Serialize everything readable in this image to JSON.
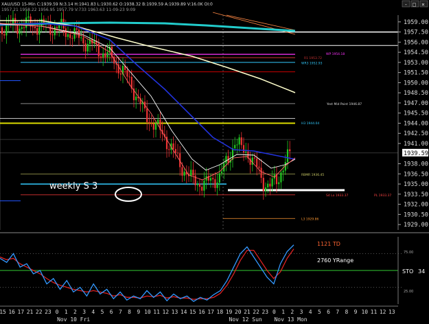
{
  "header": {
    "symbol_line": "XAU/USD 15-Min C:1939.59 N:3.14 H:1941.83 L:1930.62 O:1938.32 B:1939.59 A:1939.89 V:16.0K OI:0",
    "sub_line": "1957.21 1958.22 1956.95 1957.79 V:733 1963.63 11-09-23 9:09"
  },
  "window_controls": {
    "minimize": "-",
    "maximize": "□",
    "close": "×"
  },
  "price_axis": {
    "ticks": [
      "1959.00",
      "1957.50",
      "1956.00",
      "1954.50",
      "1953.00",
      "1951.50",
      "1950.00",
      "1948.50",
      "1947.00",
      "1945.50",
      "1944.00",
      "1942.50",
      "1941.00",
      "1939.59",
      "1938.00",
      "1936.50",
      "1935.00",
      "1933.50",
      "1932.00",
      "1930.50",
      "1929.00"
    ],
    "current": "1939.59",
    "ymin": 1928.2,
    "ymax": 1960.0
  },
  "level_labels": [
    {
      "text": "WP 1954.18",
      "price": 1954.3,
      "color": "#ff33ff"
    },
    {
      "text": "R1 1953.72",
      "price": 1953.72,
      "color": "#cc3333"
    },
    {
      "text": "WR3 1952.93",
      "price": 1952.93,
      "color": "#33ccff"
    },
    {
      "text": "Yest Mid Point 1946.87",
      "price": 1946.87,
      "color": "#dddddd"
    },
    {
      "text": "H3 1944.04",
      "price": 1944.04,
      "color": "#33ccff"
    },
    {
      "text": "RBMR 1936.45",
      "price": 1936.45,
      "color": "#cccc66"
    },
    {
      "text": "S4 Lo 1933.37",
      "price": 1933.37,
      "color": "#ff4444"
    },
    {
      "text": "PL 1933.37",
      "price": 1933.37,
      "color": "#ff4444"
    },
    {
      "text": "L3 1929.86",
      "price": 1929.86,
      "color": "#ff9933"
    }
  ],
  "annotation": {
    "weekly_s3": "weekly S 3"
  },
  "oscillator": {
    "td_label": "1121 TD",
    "yrange_label": "2760 YRange",
    "sto_label": "STO",
    "sto_value": "34",
    "level_75": "75.00",
    "level_25": "25.00"
  },
  "time_axis": {
    "hours": [
      "15",
      "16",
      "17",
      "21",
      "22",
      "23",
      "0",
      "1",
      "2",
      "3",
      "4",
      "5",
      "6",
      "7",
      "8",
      "9",
      "10",
      "11",
      "12",
      "13",
      "14",
      "15",
      "16",
      "17",
      "18",
      "19",
      "20",
      "21",
      "22",
      "23",
      "0",
      "1",
      "2",
      "3",
      "4",
      "5",
      "6",
      "7",
      "8",
      "9",
      "10",
      "11",
      "12",
      "13"
    ],
    "days": [
      {
        "text": "Nov 10 Fri",
        "index": 6
      },
      {
        "text": "Nov 12 Sun",
        "index": 25
      },
      {
        "text": "Nov 13 Mon",
        "index": 30
      }
    ]
  },
  "colors": {
    "background": "#000000",
    "sma_fast": "#ff6666",
    "sma_mid": "#ffffff",
    "ma_blue": "#2233dd",
    "ma_slow": "#ffffcc",
    "ma_cyan": "#22cccc",
    "pivot_yellow": "#dddd00",
    "stoch_k": "#3399ff",
    "stoch_d": "#dd2222",
    "bull_candle": "#22cc22",
    "bear_candle": "#ee3333"
  }
}
